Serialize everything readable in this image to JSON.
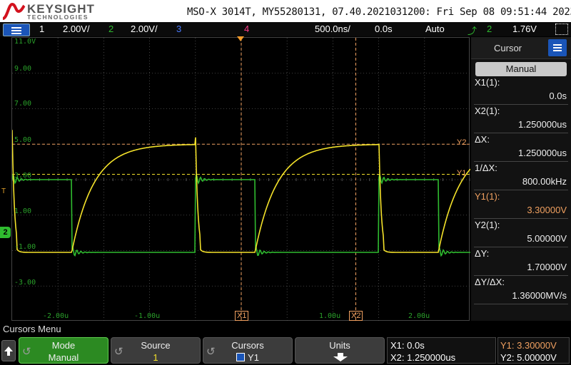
{
  "header": {
    "brand": "KEYSIGHT",
    "brand_sub": "TECHNOLOGIES",
    "instrument_line": "MSO-X 3014T, MY55280131, 07.40.2021031200: Fri Sep 08 09:51:44 2023"
  },
  "statusbar": {
    "ch1_num": "1",
    "ch1_scale": "2.00V/",
    "ch2_num": "2",
    "ch2_scale": "2.00V/",
    "ch3_num": "3",
    "ch4_num": "4",
    "timebase": "500.0ns/",
    "delay": "0.0s",
    "trigger_mode": "Auto",
    "trigger_source": "2",
    "trigger_level": "1.76V"
  },
  "colors": {
    "ch1": "#f4e22a",
    "ch2": "#2fbb2f",
    "ch3": "#4a7bff",
    "ch4": "#ff3d8a",
    "cursor": "#f0a060",
    "grid": "#555555"
  },
  "graticule": {
    "y_labels": [
      "11.0V",
      "9.00",
      "7.00",
      "5.00",
      "3.00",
      "1.00",
      "-1.00",
      "-3.00"
    ],
    "x_labels": [
      "-2.00u",
      "-1.00u",
      "1.00u",
      "2.00u"
    ],
    "cursor_tags": {
      "x1": "X1",
      "x2": "X2",
      "y1": "Y1",
      "y2": "Y2"
    },
    "trigger_marker": "T",
    "ch2_marker": "2"
  },
  "panel": {
    "title": "Cursor",
    "mode": "Manual",
    "rows": [
      {
        "label": "X1(1):",
        "value": "0.0s"
      },
      {
        "label": "X2(1):",
        "value": "1.250000us"
      },
      {
        "label": "ΔX:",
        "value": "1.250000us"
      },
      {
        "label": "1/ΔX:",
        "value": "800.00kHz"
      },
      {
        "label": "Y1(1):",
        "value": "3.30000V"
      },
      {
        "label": "Y2(1):",
        "value": "5.00000V"
      },
      {
        "label": "ΔY:",
        "value": "1.70000V"
      },
      {
        "label": "ΔY/ΔX:",
        "value": "1.36000MV/s"
      }
    ]
  },
  "softkeys": {
    "menu_title": "Cursors Menu",
    "mode_label": "Mode",
    "mode_value": "Manual",
    "source_label": "Source",
    "source_value": "1",
    "cursors_label": "Cursors",
    "cursors_value": "Y1",
    "units_label": "Units",
    "readout": {
      "x1": "X1: 0.0s",
      "x2": "X2: 1.250000us",
      "y1": "Y1: 3.30000V",
      "y2": "Y2: 5.00000V"
    }
  }
}
